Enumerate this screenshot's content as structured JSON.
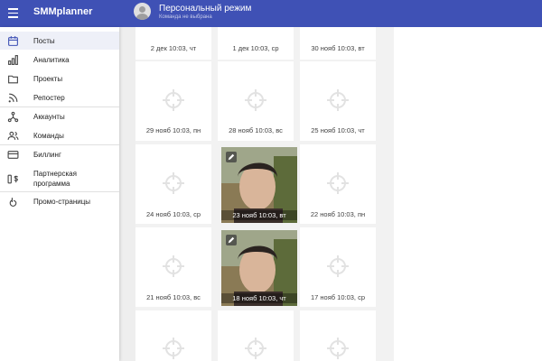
{
  "header": {
    "app_title": "SMMplanner",
    "workspace_title": "Персональный режим",
    "workspace_subtitle": "Команда не выбрана"
  },
  "sidebar": {
    "items": [
      {
        "label": "Посты",
        "icon": "calendar-icon"
      },
      {
        "label": "Аналитика",
        "icon": "bar-chart-icon"
      },
      {
        "label": "Проекты",
        "icon": "folder-icon"
      },
      {
        "label": "Репостер",
        "icon": "rss-icon"
      },
      {
        "label": "Аккаунты",
        "icon": "network-icon"
      },
      {
        "label": "Команды",
        "icon": "people-icon"
      },
      {
        "label": "Биллинг",
        "icon": "card-icon"
      },
      {
        "label": "Партнерская программа",
        "icon": "dollar-icon"
      },
      {
        "label": "Промо-страницы",
        "icon": "hand-icon"
      }
    ]
  },
  "posts": [
    {
      "date": "2 дек 10:03, чт"
    },
    {
      "date": "1 дек 10:03, ср"
    },
    {
      "date": "30 нояб 10:03, вт"
    },
    {
      "date": "29 нояб 10:03, пн"
    },
    {
      "date": "28 нояб 10:03, вс"
    },
    {
      "date": "25 нояб 10:03, чт"
    },
    {
      "date": "24 нояб 10:03, ср"
    },
    {
      "date": "23 нояб 10:03, вт",
      "has_photo": true
    },
    {
      "date": "22 нояб 10:03, пн"
    },
    {
      "date": "21 нояб 10:03, вс"
    },
    {
      "date": "18 нояб 10:03, чт",
      "has_photo": true
    },
    {
      "date": "17 нояб 10:03, ср"
    }
  ],
  "colors": {
    "topbar": "#3f51b5",
    "accent": "#3f51b5"
  }
}
